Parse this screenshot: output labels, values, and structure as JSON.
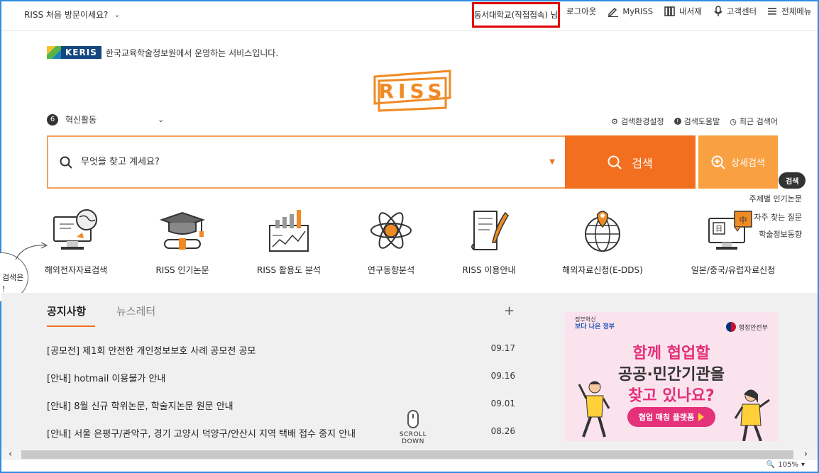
{
  "topbar": {
    "first_visit": "RISS 처음 방문이세요?",
    "user": "동서대학교(직접접속) 님",
    "nav": [
      "로그아웃",
      "MyRISS",
      "내서재",
      "고객센터",
      "전체메뉴"
    ]
  },
  "keris": {
    "logo_text": "KERIS",
    "tagline": "한국교육학술정보원에서 운영하는 서비스입니다."
  },
  "logo": "RISS",
  "innovation": {
    "num": "6",
    "label": "혁신활동"
  },
  "search_tools": [
    "검색환경설정",
    "검색도움말",
    "최근 검색어"
  ],
  "search": {
    "placeholder": "무엇을 찾고 계세요?",
    "button": "검색",
    "advanced": "상세검색"
  },
  "side_panel": {
    "tag": "검색",
    "links": [
      "주제별 인기논문",
      "자주 찾는 질문",
      "학술정보동향"
    ]
  },
  "services": [
    {
      "label": "해외전자자료검색",
      "icon": "monitor-globe-icon"
    },
    {
      "label": "RISS 인기논문",
      "icon": "graduation-cap-icon"
    },
    {
      "label": "RISS 활용도 분석",
      "icon": "growth-chart-icon"
    },
    {
      "label": "연구동향분석",
      "icon": "atom-icon"
    },
    {
      "label": "RISS 이용안내",
      "icon": "document-quill-icon"
    },
    {
      "label": "해외자료신청(E-DDS)",
      "icon": "globe-pin-icon"
    },
    {
      "label": "일본/중국/유럽자료신청",
      "icon": "monitor-language-icon"
    }
  ],
  "bubble": [
    "검색은",
    "!"
  ],
  "tabs": [
    "공지사항",
    "뉴스레터"
  ],
  "notices": [
    {
      "title": "[공모전] 제1회 안전한 개인정보보호 사례 공모전 공모",
      "date": "09.17"
    },
    {
      "title": "[안내] hotmail 이용불가 안내",
      "date": "09.16"
    },
    {
      "title": "[안내] 8월 신규 학위논문, 학술지논문 원문 안내",
      "date": "09.01"
    },
    {
      "title": "[안내] 서울 은평구/관악구, 경기 고양시 덕양구/안산시 지역 택배 접수 중지 안내",
      "date": "08.26"
    }
  ],
  "scroll_down": "SCROLL DOWN",
  "banner": {
    "gov_line1": "정부혁신",
    "gov_line2": "보다 나은 정부",
    "ministry": "행정안전부",
    "line1": "함께 협업할",
    "line2": "공공·민간기관을",
    "line3": "찾고 있나요?",
    "cta": "협업 매칭 플랫폼"
  },
  "status": {
    "zoom": "105%"
  },
  "colors": {
    "accent": "#f26f1f",
    "accent_light": "#f9a142",
    "highlight_border": "#e10000",
    "banner_pink": "#e5307a"
  }
}
